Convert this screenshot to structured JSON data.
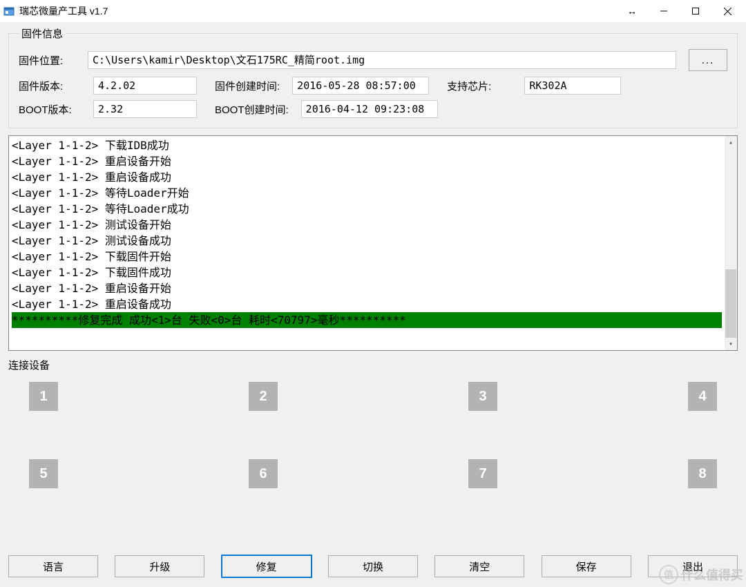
{
  "window": {
    "title": "瑞芯微量产工具 v1.7"
  },
  "firmware": {
    "group_label": "固件信息",
    "path_label": "固件位置:",
    "path_value": "C:\\Users\\kamir\\Desktop\\文石175RC_精简root.img",
    "browse_label": "...",
    "version_label": "固件版本:",
    "version_value": "4.2.02",
    "build_time_label": "固件创建时间:",
    "build_time_value": "2016-05-28 08:57:00",
    "chip_label": "支持芯片:",
    "chip_value": "RK302A",
    "boot_version_label": "BOOT版本:",
    "boot_version_value": "2.32",
    "boot_build_time_label": "BOOT创建时间:",
    "boot_build_time_value": "2016-04-12 09:23:08"
  },
  "log": {
    "lines": [
      "<Layer 1-1-2> 下载IDB成功",
      "<Layer 1-1-2> 重启设备开始",
      "<Layer 1-1-2> 重启设备成功",
      "<Layer 1-1-2> 等待Loader开始",
      "<Layer 1-1-2> 等待Loader成功",
      "<Layer 1-1-2> 测试设备开始",
      "<Layer 1-1-2> 测试设备成功",
      "<Layer 1-1-2> 下载固件开始",
      "<Layer 1-1-2> 下载固件成功",
      "<Layer 1-1-2> 重启设备开始",
      "<Layer 1-1-2> 重启设备成功"
    ],
    "result_line": "**********修复完成 成功<1>台 失败<0>台 耗时<70797>毫秒**********"
  },
  "devices": {
    "group_label": "连接设备",
    "slots": [
      "1",
      "2",
      "3",
      "4",
      "5",
      "6",
      "7",
      "8"
    ]
  },
  "buttons": {
    "language": "语言",
    "upgrade": "升级",
    "repair": "修复",
    "switch": "切换",
    "clear": "清空",
    "save": "保存",
    "exit": "退出"
  },
  "watermark": {
    "badge": "值",
    "text": "什么值得买"
  },
  "scrollbar": {
    "thumb_top_pct": 64,
    "thumb_height_pct": 36
  }
}
